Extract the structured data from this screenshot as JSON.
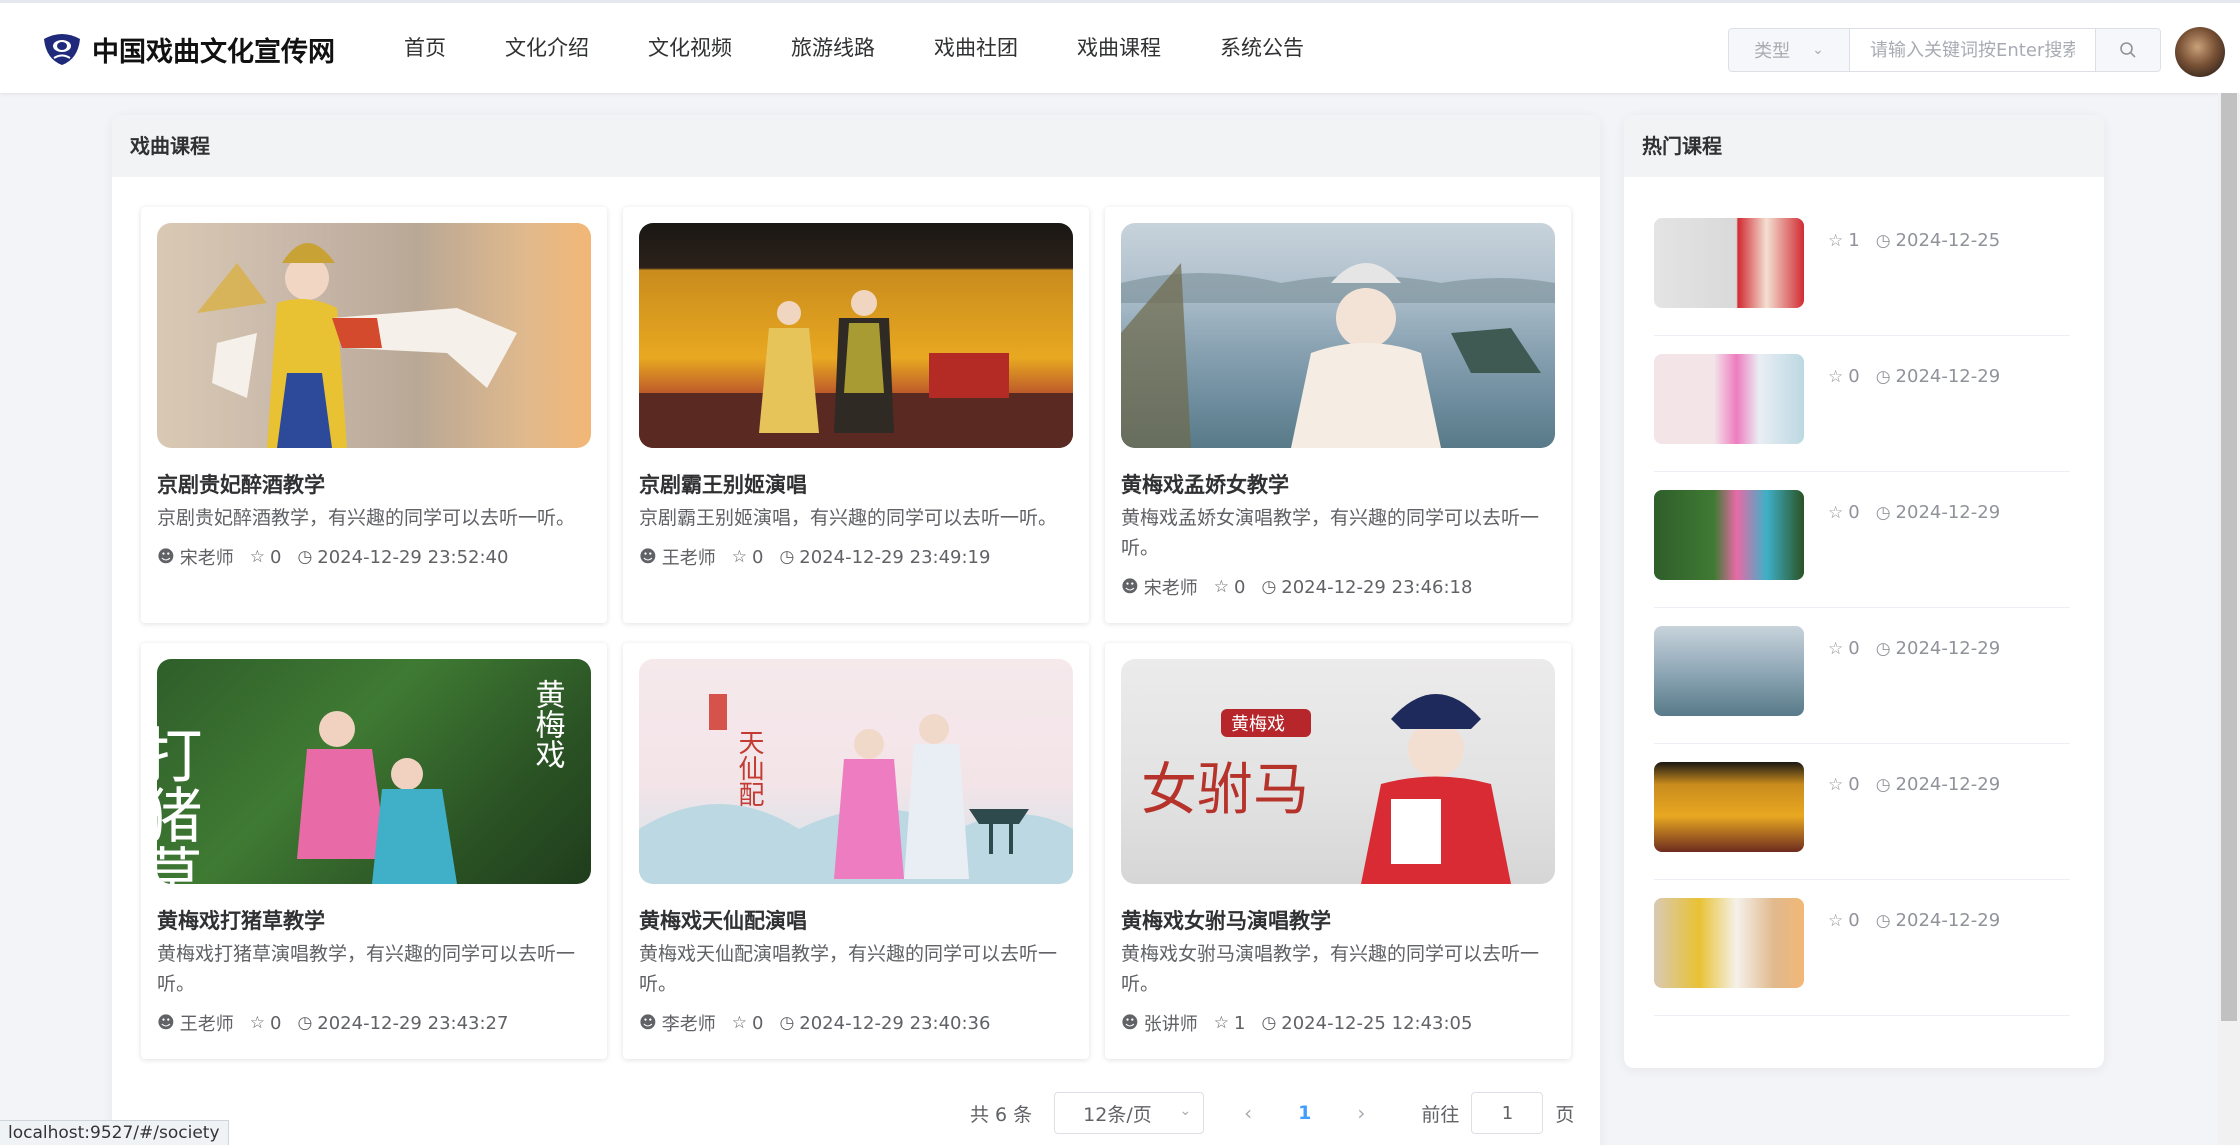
{
  "header": {
    "site_title": "中国戏曲文化宣传网",
    "nav": [
      "首页",
      "文化介绍",
      "文化视频",
      "旅游线路",
      "戏曲社团",
      "戏曲课程",
      "系统公告"
    ],
    "type_select": "类型",
    "search_placeholder": "请输入关键词按Enter搜索"
  },
  "main": {
    "panel_title": "戏曲课程",
    "courses": [
      {
        "title": "京剧贵妃醉酒教学",
        "desc": "京剧贵妃醉酒教学，有兴趣的同学可以去听一听。",
        "teacher": "宋老师",
        "stars": "0",
        "time": "2024-12-29 23:52:40"
      },
      {
        "title": "京剧霸王别姬演唱",
        "desc": "京剧霸王别姬演唱，有兴趣的同学可以去听一听。",
        "teacher": "王老师",
        "stars": "0",
        "time": "2024-12-29 23:49:19"
      },
      {
        "title": "黄梅戏孟娇女教学",
        "desc": "黄梅戏孟娇女演唱教学，有兴趣的同学可以去听一听。",
        "teacher": "宋老师",
        "stars": "0",
        "time": "2024-12-29 23:46:18"
      },
      {
        "title": "黄梅戏打猪草教学",
        "desc": "黄梅戏打猪草演唱教学，有兴趣的同学可以去听一听。",
        "teacher": "王老师",
        "stars": "0",
        "time": "2024-12-29 23:43:27"
      },
      {
        "title": "黄梅戏天仙配演唱",
        "desc": "黄梅戏天仙配演唱教学，有兴趣的同学可以去听一听。",
        "teacher": "李老师",
        "stars": "0",
        "time": "2024-12-29 23:40:36"
      },
      {
        "title": "黄梅戏女驸马演唱教学",
        "desc": "黄梅戏女驸马演唱教学，有兴趣的同学可以去听一听。",
        "teacher": "张讲师",
        "stars": "1",
        "time": "2024-12-25 12:43:05"
      }
    ],
    "pagination": {
      "total": "共 6 条",
      "page_size": "12条/页",
      "current": "1",
      "goto_prefix": "前往",
      "goto_value": "1",
      "goto_suffix": "页"
    }
  },
  "side": {
    "panel_title": "热门课程",
    "items": [
      {
        "stars": "1",
        "date": "2024-12-25"
      },
      {
        "stars": "0",
        "date": "2024-12-29"
      },
      {
        "stars": "0",
        "date": "2024-12-29"
      },
      {
        "stars": "0",
        "date": "2024-12-29"
      },
      {
        "stars": "0",
        "date": "2024-12-29"
      },
      {
        "stars": "0",
        "date": "2024-12-29"
      }
    ]
  },
  "thumb_text": {
    "dazhucao": "打猪草",
    "huangmeixi": "黄梅戏",
    "tianxianpei": "天仙配",
    "nvfuma": "女驸马",
    "huangmeixi_badge": "黄梅戏"
  },
  "status_url": "localhost:9527/#/society",
  "colors": {
    "accent": "#409eff",
    "text": "#303133",
    "muted": "#606266",
    "placeholder": "#a8abb2"
  }
}
